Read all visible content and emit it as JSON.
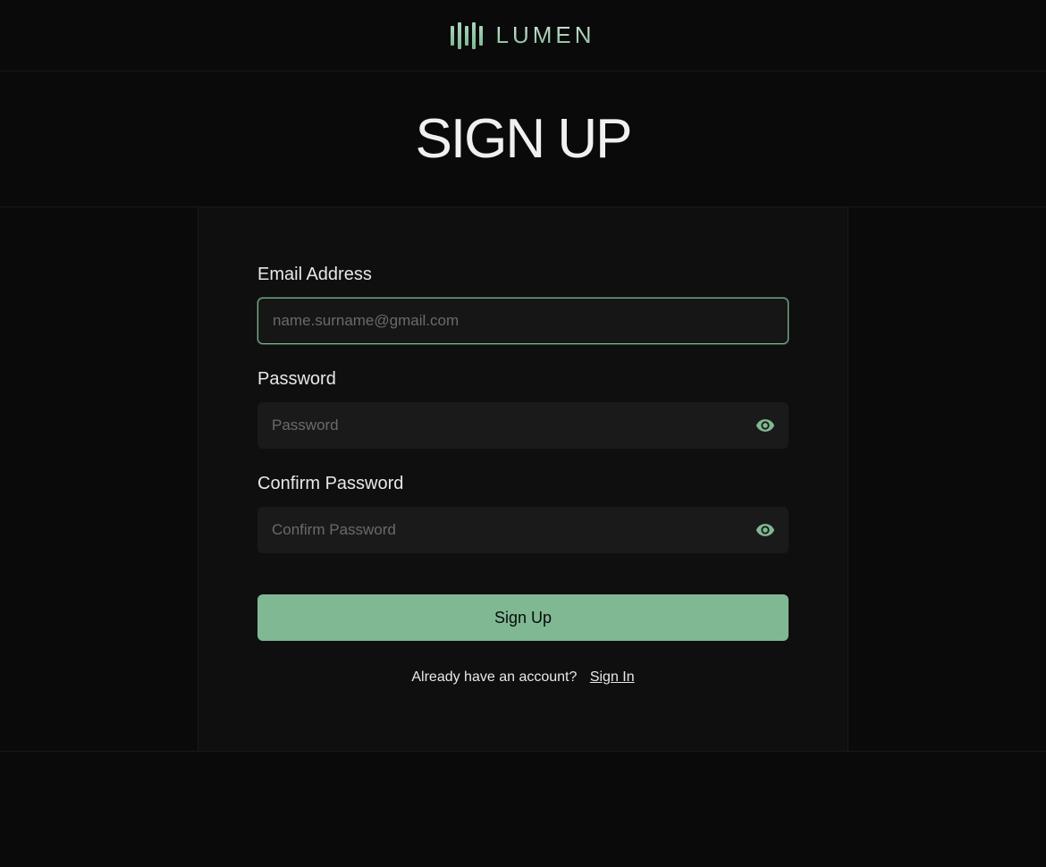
{
  "brand": {
    "name": "LUMEN"
  },
  "page": {
    "title": "SIGN UP"
  },
  "form": {
    "email": {
      "label": "Email Address",
      "placeholder": "name.surname@gmail.com",
      "value": ""
    },
    "password": {
      "label": "Password",
      "placeholder": "Password",
      "value": ""
    },
    "confirm_password": {
      "label": "Confirm Password",
      "placeholder": "Confirm Password",
      "value": ""
    },
    "submit_label": "Sign Up"
  },
  "footer": {
    "prompt": "Already have an account?",
    "link_label": "Sign In"
  },
  "colors": {
    "accent": "#7fb893",
    "background": "#0a0a0a",
    "card": "#0f0f0f",
    "input": "#1a1a1a"
  }
}
